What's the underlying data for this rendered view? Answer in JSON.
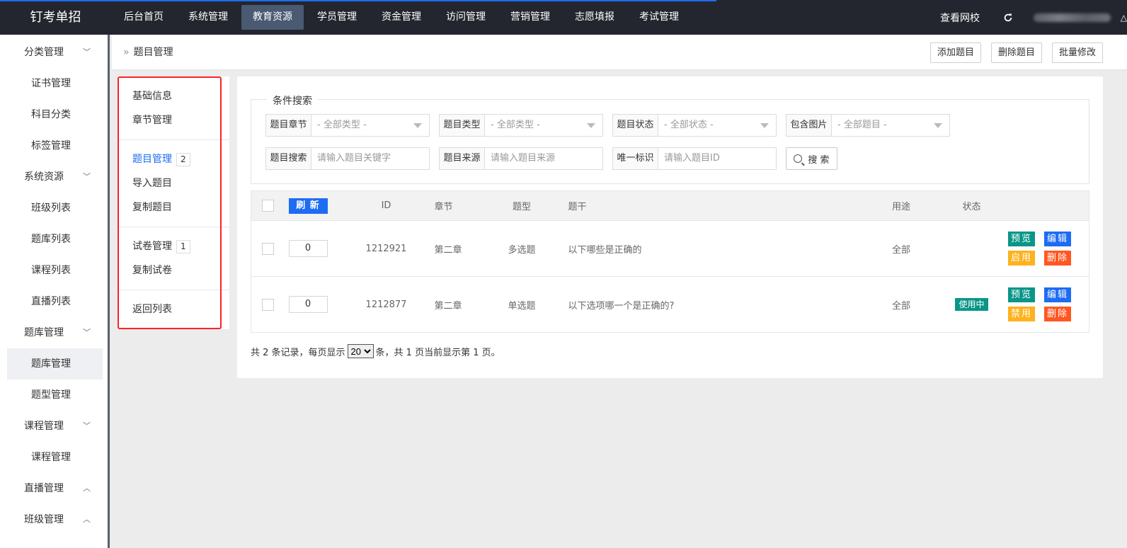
{
  "app": {
    "title": "钉考单招"
  },
  "topnav": [
    {
      "label": "后台首页"
    },
    {
      "label": "系统管理"
    },
    {
      "label": "教育资源"
    },
    {
      "label": "学员管理"
    },
    {
      "label": "资金管理"
    },
    {
      "label": "访问管理"
    },
    {
      "label": "营销管理"
    },
    {
      "label": "志愿填报"
    },
    {
      "label": "考试管理"
    }
  ],
  "topright": {
    "view_site": "查看网校",
    "refresh_icon": "refresh-icon"
  },
  "sidebar": {
    "groups": [
      {
        "label": "分类管理",
        "items": [
          "证书管理",
          "科目分类",
          "标签管理"
        ]
      },
      {
        "label": "系统资源",
        "items": [
          "班级列表",
          "题库列表",
          "课程列表",
          "直播列表"
        ]
      },
      {
        "label": "题库管理",
        "items": [
          "题库管理",
          "题型管理"
        ]
      },
      {
        "label": "课程管理",
        "items": [
          "课程管理"
        ]
      },
      {
        "label": "直播管理",
        "items": []
      },
      {
        "label": "班级管理",
        "items": []
      }
    ]
  },
  "header": {
    "breadcrumb": "题目管理",
    "add_label": "添加题目",
    "delete_label": "删除题目",
    "batch_label": "批量修改"
  },
  "submenu": {
    "basic": "基础信息",
    "chapter": "章节管理",
    "question": "题目管理",
    "question_count": "2",
    "import": "导入题目",
    "copy_question": "复制题目",
    "paper": "试卷管理",
    "paper_count": "1",
    "copy_paper": "复制试卷",
    "back": "返回列表"
  },
  "search": {
    "legend": "条件搜索",
    "chapter_label": "题目章节",
    "chapter_value": "- 全部类型 -",
    "type_label": "题目类型",
    "type_value": "- 全部类型 -",
    "status_label": "题目状态",
    "status_value": "- 全部状态 -",
    "image_label": "包含图片",
    "image_value": "- 全部题目 -",
    "keyword_label": "题目搜索",
    "keyword_placeholder": "请输入题目关键字",
    "source_label": "题目来源",
    "source_placeholder": "请输入题目来源",
    "uid_label": "唯一标识",
    "uid_placeholder": "请输入题目ID",
    "button": "搜 索"
  },
  "table": {
    "refresh": "刷 新",
    "headers": {
      "id": "ID",
      "chapter": "章节",
      "type": "题型",
      "stem": "题干",
      "usage": "用途",
      "status": "状态"
    },
    "rows": [
      {
        "sort": "0",
        "id": "1212921",
        "chapter": "第二章",
        "type": "多选题",
        "stem": "以下哪些是正确的",
        "usage": "全部",
        "status": "",
        "preview": "预览",
        "edit": "编辑",
        "toggle": "启用",
        "delete": "删除"
      },
      {
        "sort": "0",
        "id": "1212877",
        "chapter": "第二章",
        "type": "单选题",
        "stem": "以下选项哪一个是正确的?",
        "usage": "全部",
        "status": "使用中",
        "preview": "预览",
        "edit": "编辑",
        "toggle": "禁用",
        "delete": "删除"
      }
    ]
  },
  "pager": {
    "prefix": "共 2 条记录，每页显示",
    "page_size": "20",
    "suffix": "条，共 1 页当前显示第 1 页。"
  },
  "colors": {
    "primary": "#1e6cf2",
    "teal": "#099688",
    "orange": "#fdb21e",
    "red": "#ff5722",
    "topbar": "#23262e"
  }
}
